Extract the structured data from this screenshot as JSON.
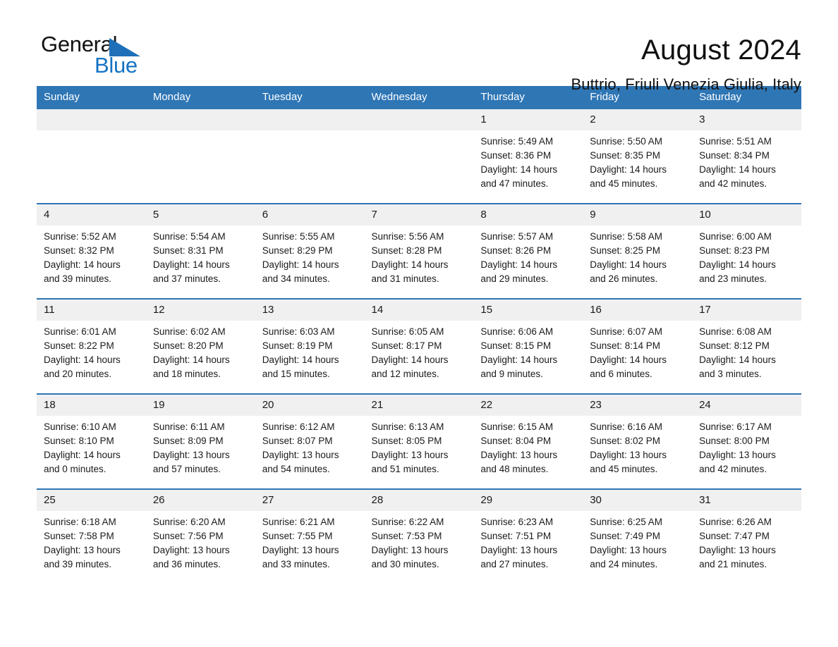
{
  "brand": {
    "name_part1": "General",
    "name_part2": "Blue",
    "logo_icon": "triangle-flag-icon",
    "accent_color": "#1573c4"
  },
  "header": {
    "month_title": "August 2024",
    "location": "Buttrio, Friuli Venezia Giulia, Italy",
    "header_bg_color": "#2f76b5"
  },
  "calendar": {
    "weekday_headers": [
      "Sunday",
      "Monday",
      "Tuesday",
      "Wednesday",
      "Thursday",
      "Friday",
      "Saturday"
    ],
    "weeks": [
      [
        {
          "day": "",
          "empty": true
        },
        {
          "day": "",
          "empty": true
        },
        {
          "day": "",
          "empty": true
        },
        {
          "day": "",
          "empty": true
        },
        {
          "day": "1",
          "sunrise": "Sunrise: 5:49 AM",
          "sunset": "Sunset: 8:36 PM",
          "daylight": "Daylight: 14 hours and 47 minutes."
        },
        {
          "day": "2",
          "sunrise": "Sunrise: 5:50 AM",
          "sunset": "Sunset: 8:35 PM",
          "daylight": "Daylight: 14 hours and 45 minutes."
        },
        {
          "day": "3",
          "sunrise": "Sunrise: 5:51 AM",
          "sunset": "Sunset: 8:34 PM",
          "daylight": "Daylight: 14 hours and 42 minutes."
        }
      ],
      [
        {
          "day": "4",
          "sunrise": "Sunrise: 5:52 AM",
          "sunset": "Sunset: 8:32 PM",
          "daylight": "Daylight: 14 hours and 39 minutes."
        },
        {
          "day": "5",
          "sunrise": "Sunrise: 5:54 AM",
          "sunset": "Sunset: 8:31 PM",
          "daylight": "Daylight: 14 hours and 37 minutes."
        },
        {
          "day": "6",
          "sunrise": "Sunrise: 5:55 AM",
          "sunset": "Sunset: 8:29 PM",
          "daylight": "Daylight: 14 hours and 34 minutes."
        },
        {
          "day": "7",
          "sunrise": "Sunrise: 5:56 AM",
          "sunset": "Sunset: 8:28 PM",
          "daylight": "Daylight: 14 hours and 31 minutes."
        },
        {
          "day": "8",
          "sunrise": "Sunrise: 5:57 AM",
          "sunset": "Sunset: 8:26 PM",
          "daylight": "Daylight: 14 hours and 29 minutes."
        },
        {
          "day": "9",
          "sunrise": "Sunrise: 5:58 AM",
          "sunset": "Sunset: 8:25 PM",
          "daylight": "Daylight: 14 hours and 26 minutes."
        },
        {
          "day": "10",
          "sunrise": "Sunrise: 6:00 AM",
          "sunset": "Sunset: 8:23 PM",
          "daylight": "Daylight: 14 hours and 23 minutes."
        }
      ],
      [
        {
          "day": "11",
          "sunrise": "Sunrise: 6:01 AM",
          "sunset": "Sunset: 8:22 PM",
          "daylight": "Daylight: 14 hours and 20 minutes."
        },
        {
          "day": "12",
          "sunrise": "Sunrise: 6:02 AM",
          "sunset": "Sunset: 8:20 PM",
          "daylight": "Daylight: 14 hours and 18 minutes."
        },
        {
          "day": "13",
          "sunrise": "Sunrise: 6:03 AM",
          "sunset": "Sunset: 8:19 PM",
          "daylight": "Daylight: 14 hours and 15 minutes."
        },
        {
          "day": "14",
          "sunrise": "Sunrise: 6:05 AM",
          "sunset": "Sunset: 8:17 PM",
          "daylight": "Daylight: 14 hours and 12 minutes."
        },
        {
          "day": "15",
          "sunrise": "Sunrise: 6:06 AM",
          "sunset": "Sunset: 8:15 PM",
          "daylight": "Daylight: 14 hours and 9 minutes."
        },
        {
          "day": "16",
          "sunrise": "Sunrise: 6:07 AM",
          "sunset": "Sunset: 8:14 PM",
          "daylight": "Daylight: 14 hours and 6 minutes."
        },
        {
          "day": "17",
          "sunrise": "Sunrise: 6:08 AM",
          "sunset": "Sunset: 8:12 PM",
          "daylight": "Daylight: 14 hours and 3 minutes."
        }
      ],
      [
        {
          "day": "18",
          "sunrise": "Sunrise: 6:10 AM",
          "sunset": "Sunset: 8:10 PM",
          "daylight": "Daylight: 14 hours and 0 minutes."
        },
        {
          "day": "19",
          "sunrise": "Sunrise: 6:11 AM",
          "sunset": "Sunset: 8:09 PM",
          "daylight": "Daylight: 13 hours and 57 minutes."
        },
        {
          "day": "20",
          "sunrise": "Sunrise: 6:12 AM",
          "sunset": "Sunset: 8:07 PM",
          "daylight": "Daylight: 13 hours and 54 minutes."
        },
        {
          "day": "21",
          "sunrise": "Sunrise: 6:13 AM",
          "sunset": "Sunset: 8:05 PM",
          "daylight": "Daylight: 13 hours and 51 minutes."
        },
        {
          "day": "22",
          "sunrise": "Sunrise: 6:15 AM",
          "sunset": "Sunset: 8:04 PM",
          "daylight": "Daylight: 13 hours and 48 minutes."
        },
        {
          "day": "23",
          "sunrise": "Sunrise: 6:16 AM",
          "sunset": "Sunset: 8:02 PM",
          "daylight": "Daylight: 13 hours and 45 minutes."
        },
        {
          "day": "24",
          "sunrise": "Sunrise: 6:17 AM",
          "sunset": "Sunset: 8:00 PM",
          "daylight": "Daylight: 13 hours and 42 minutes."
        }
      ],
      [
        {
          "day": "25",
          "sunrise": "Sunrise: 6:18 AM",
          "sunset": "Sunset: 7:58 PM",
          "daylight": "Daylight: 13 hours and 39 minutes."
        },
        {
          "day": "26",
          "sunrise": "Sunrise: 6:20 AM",
          "sunset": "Sunset: 7:56 PM",
          "daylight": "Daylight: 13 hours and 36 minutes."
        },
        {
          "day": "27",
          "sunrise": "Sunrise: 6:21 AM",
          "sunset": "Sunset: 7:55 PM",
          "daylight": "Daylight: 13 hours and 33 minutes."
        },
        {
          "day": "28",
          "sunrise": "Sunrise: 6:22 AM",
          "sunset": "Sunset: 7:53 PM",
          "daylight": "Daylight: 13 hours and 30 minutes."
        },
        {
          "day": "29",
          "sunrise": "Sunrise: 6:23 AM",
          "sunset": "Sunset: 7:51 PM",
          "daylight": "Daylight: 13 hours and 27 minutes."
        },
        {
          "day": "30",
          "sunrise": "Sunrise: 6:25 AM",
          "sunset": "Sunset: 7:49 PM",
          "daylight": "Daylight: 13 hours and 24 minutes."
        },
        {
          "day": "31",
          "sunrise": "Sunrise: 6:26 AM",
          "sunset": "Sunset: 7:47 PM",
          "daylight": "Daylight: 13 hours and 21 minutes."
        }
      ]
    ]
  }
}
